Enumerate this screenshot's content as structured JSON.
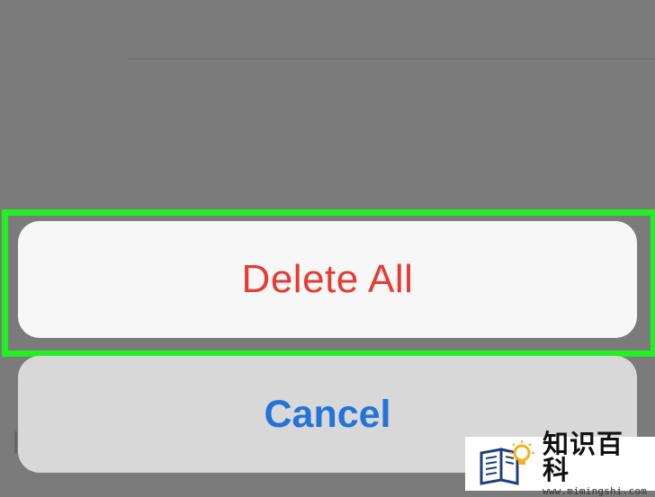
{
  "action_sheet": {
    "primary_action": {
      "label": "Delete All",
      "color": "#e53b33"
    },
    "cancel_action": {
      "label": "Cancel",
      "color": "#2373d9"
    }
  },
  "highlight": {
    "color": "#22f022",
    "target": "Delete All"
  },
  "watermark": {
    "title": "知识百科",
    "url": "www.mimingshi.com",
    "icon": "book-lightbulb-icon"
  },
  "colors": {
    "backdrop": "#7b7b7b",
    "button_light": "#f7f7f7",
    "button_cancel": "#d8d8d8"
  }
}
